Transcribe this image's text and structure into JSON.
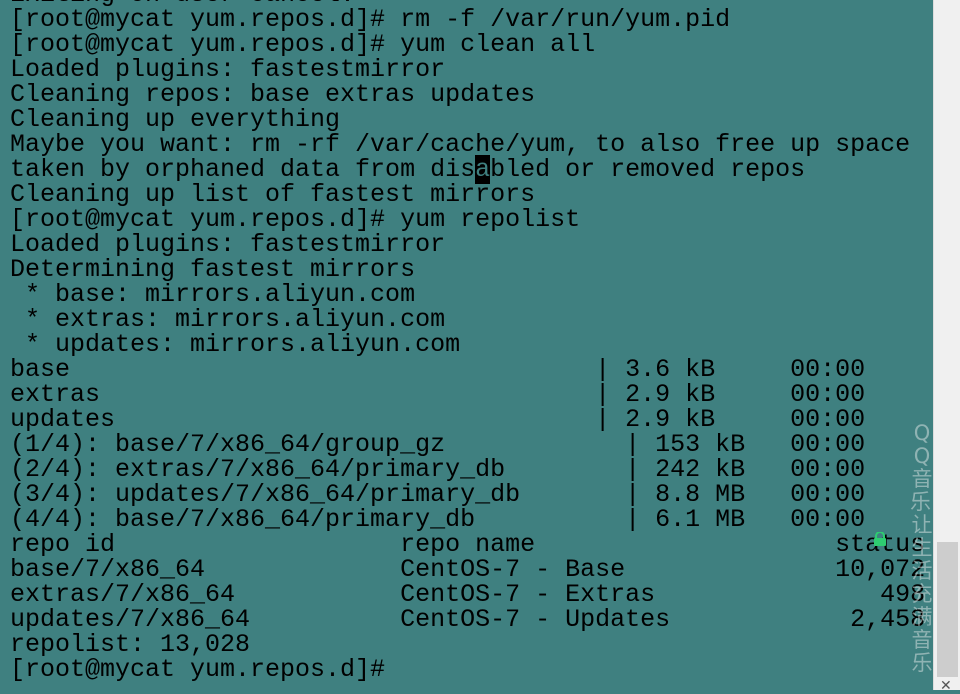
{
  "terminal": {
    "lines_before_cursor": [
      "Exiting on user cancel.",
      "[root@mycat yum.repos.d]# rm -f /var/run/yum.pid",
      "[root@mycat yum.repos.d]# yum clean all",
      "Loaded plugins: fastestmirror",
      "Cleaning repos: base extras updates",
      "Cleaning up everything",
      "Maybe you want: rm -rf /var/cache/yum, to also free up space"
    ],
    "cursor_line": {
      "before": "taken by orphaned data from dis",
      "cursor": "a",
      "after": "bled or removed repos"
    },
    "lines_after_cursor": [
      "Cleaning up list of fastest mirrors",
      "[root@mycat yum.repos.d]# yum repolist",
      "Loaded plugins: fastestmirror",
      "Determining fastest mirrors",
      " * base: mirrors.aliyun.com",
      " * extras: mirrors.aliyun.com",
      " * updates: mirrors.aliyun.com",
      "base                                   | 3.6 kB     00:00",
      "extras                                 | 2.9 kB     00:00",
      "updates                                | 2.9 kB     00:00",
      "(1/4): base/7/x86_64/group_gz            | 153 kB   00:00",
      "(2/4): extras/7/x86_64/primary_db        | 242 kB   00:00",
      "(3/4): updates/7/x86_64/primary_db       | 8.8 MB   00:00",
      "(4/4): base/7/x86_64/primary_db          | 6.1 MB   00:00",
      "repo id                   repo name                    status",
      "base/7/x86_64             CentOS-7 - Base              10,072",
      "extras/7/x86_64           CentOS-7 - Extras               498",
      "updates/7/x86_64          CentOS-7 - Updates            2,458",
      "repolist: 13,028",
      "[root@mycat yum.repos.d]# "
    ]
  },
  "watermark": "QQ音乐，让生活充满音乐",
  "icons": {
    "lock": "lock-icon",
    "close": "close-icon"
  },
  "colors": {
    "background": "#3f8080",
    "text": "#000000",
    "lock": "#2ecc71"
  }
}
